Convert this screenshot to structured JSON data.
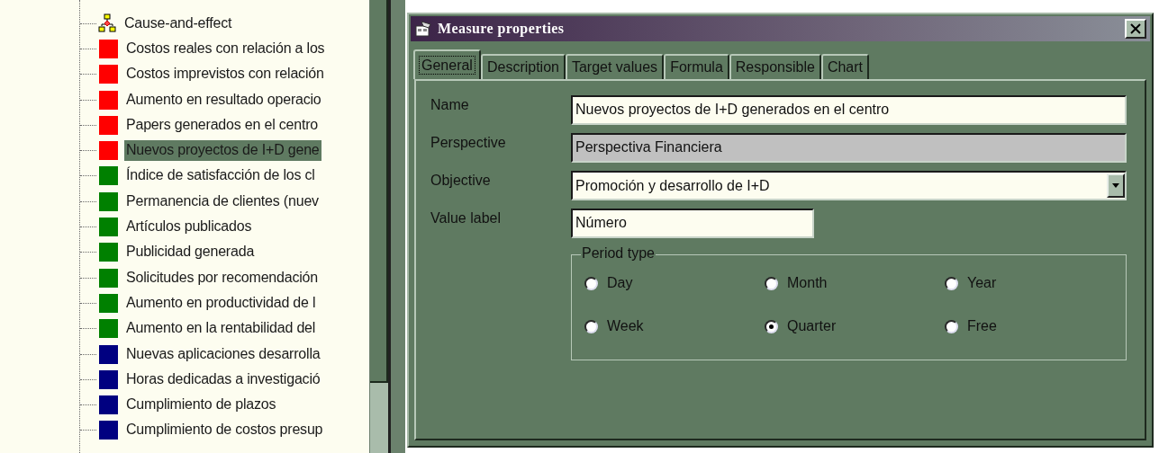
{
  "tree": {
    "items": [
      {
        "kind": "diagram",
        "label": "Cause-and-effect",
        "selected": false
      },
      {
        "kind": "measure",
        "color": "#ff0000",
        "label": "Costos reales con relación a los",
        "selected": false
      },
      {
        "kind": "measure",
        "color": "#ff0000",
        "label": "Costos imprevistos con relación",
        "selected": false
      },
      {
        "kind": "measure",
        "color": "#ff0000",
        "label": "Aumento en resultado operacio",
        "selected": false
      },
      {
        "kind": "measure",
        "color": "#ff0000",
        "label": "Papers generados en el centro",
        "selected": false
      },
      {
        "kind": "measure",
        "color": "#ff0000",
        "label": "Nuevos proyectos de I+D gene",
        "selected": true
      },
      {
        "kind": "measure",
        "color": "#008000",
        "label": "Índice de satisfacción de los cl",
        "selected": false
      },
      {
        "kind": "measure",
        "color": "#008000",
        "label": "Permanencia de clientes (nuev",
        "selected": false
      },
      {
        "kind": "measure",
        "color": "#008000",
        "label": "Artículos publicados",
        "selected": false
      },
      {
        "kind": "measure",
        "color": "#008000",
        "label": "Publicidad generada",
        "selected": false
      },
      {
        "kind": "measure",
        "color": "#008000",
        "label": "Solicitudes por recomendación",
        "selected": false
      },
      {
        "kind": "measure",
        "color": "#008000",
        "label": "Aumento en productividad de l",
        "selected": false
      },
      {
        "kind": "measure",
        "color": "#008000",
        "label": "Aumento en la rentabilidad del",
        "selected": false
      },
      {
        "kind": "measure",
        "color": "#000080",
        "label": "Nuevas aplicaciones desarrolla",
        "selected": false
      },
      {
        "kind": "measure",
        "color": "#000080",
        "label": "Horas dedicadas a investigació",
        "selected": false
      },
      {
        "kind": "measure",
        "color": "#000080",
        "label": "Cumplimiento de plazos",
        "selected": false
      },
      {
        "kind": "measure",
        "color": "#000080",
        "label": "Cumplimiento de costos presup",
        "selected": false
      }
    ]
  },
  "dialog": {
    "title": "Measure properties",
    "tabs": [
      {
        "label": "General",
        "selected": true
      },
      {
        "label": "Description",
        "selected": false
      },
      {
        "label": "Target values",
        "selected": false
      },
      {
        "label": "Formula",
        "selected": false
      },
      {
        "label": "Responsible",
        "selected": false
      },
      {
        "label": "Chart",
        "selected": false
      }
    ],
    "fields": [
      {
        "kind": "text",
        "label": "Name",
        "value": "Nuevos proyectos de I+D generados en el centro",
        "disabled": false
      },
      {
        "kind": "text",
        "label": "Perspective",
        "value": "Perspectiva Financiera",
        "disabled": true
      },
      {
        "kind": "dropdown",
        "label": "Objective",
        "value": "Promoción y desarrollo de I+D",
        "disabled": false
      },
      {
        "kind": "short",
        "label": "Value label",
        "value": "Número",
        "disabled": false
      }
    ],
    "period_type": {
      "legend": "Period type",
      "options": [
        {
          "label": "Day",
          "selected": false
        },
        {
          "label": "Month",
          "selected": false
        },
        {
          "label": "Year",
          "selected": false
        },
        {
          "label": "Week",
          "selected": false
        },
        {
          "label": "Quarter",
          "selected": true
        },
        {
          "label": "Free",
          "selected": false
        }
      ]
    }
  }
}
